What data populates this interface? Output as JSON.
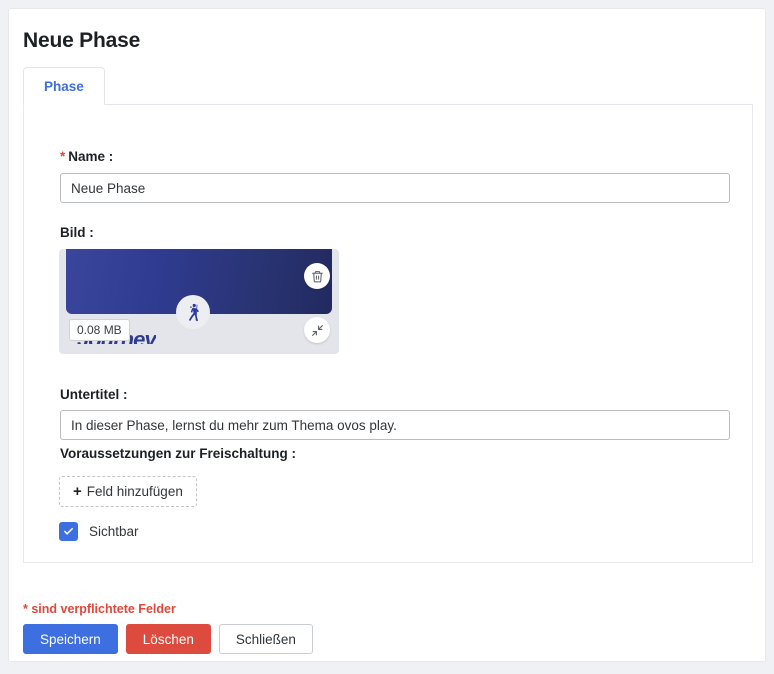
{
  "page": {
    "title": "Neue Phase"
  },
  "tabs": [
    {
      "label": "Phase",
      "active": true
    }
  ],
  "form": {
    "name": {
      "label": "Name :",
      "required_marker": "*",
      "value": "Neue Phase"
    },
    "image": {
      "label": "Bild :",
      "size_badge": "0.08 MB",
      "banner_caption": "Journey",
      "delete_icon": "trash-icon",
      "collapse_icon": "compress-icon",
      "center_icon": "hiker-icon",
      "gradient_from": "#39469c",
      "gradient_to": "#222a5e"
    },
    "subtitle": {
      "label": "Untertitel :",
      "value": "In dieser Phase, lernst du mehr zum Thema ovos play."
    },
    "prerequisites": {
      "label": "Voraussetzungen zur Freischaltung :",
      "add_button_label": "Feld hinzufügen",
      "add_button_icon": "plus-icon"
    },
    "visible": {
      "label": "Sichtbar",
      "checked": true,
      "check_icon": "check-icon"
    }
  },
  "footer": {
    "required_note": "* sind verpflichtete Felder",
    "buttons": [
      {
        "label": "Speichern",
        "style": "primary",
        "color": "#3d6fe0"
      },
      {
        "label": "Löschen",
        "style": "danger",
        "color": "#dd4b3e"
      },
      {
        "label": "Schließen",
        "style": "default",
        "color": "#ffffff"
      }
    ]
  }
}
